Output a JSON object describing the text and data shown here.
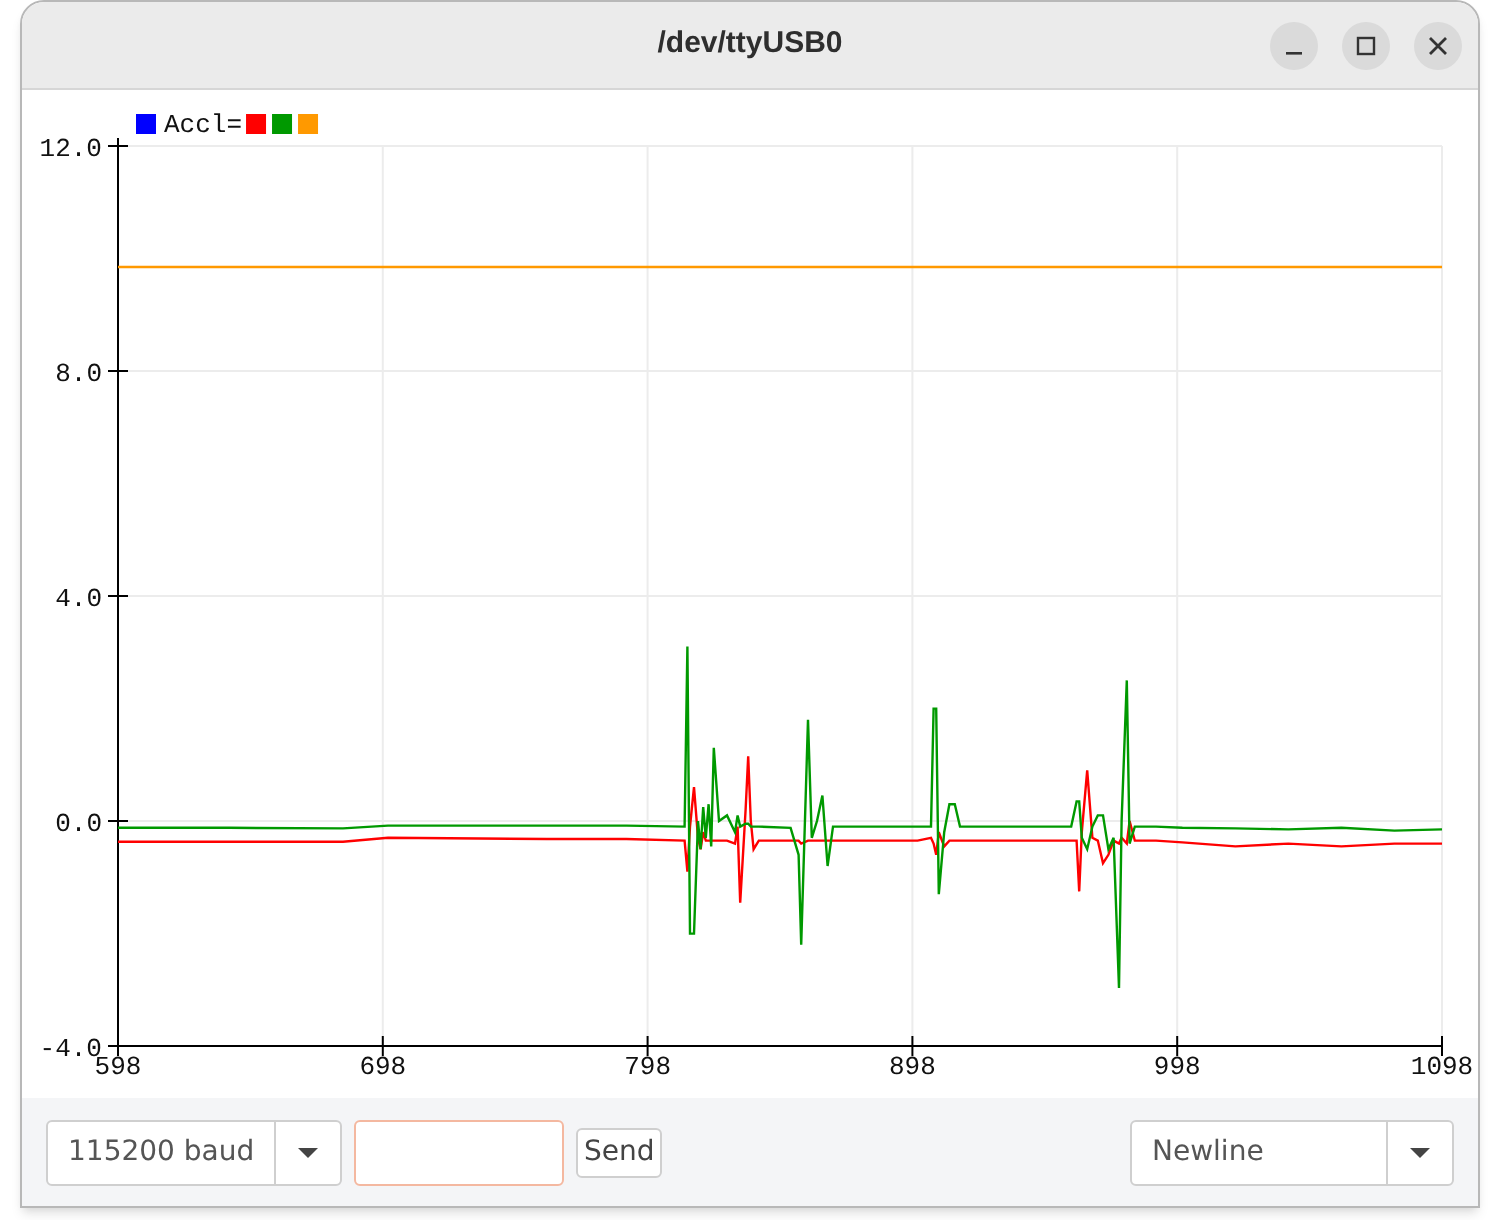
{
  "window": {
    "title": "/dev/ttyUSB0"
  },
  "plot": {
    "legend": {
      "label": "Accl=",
      "color": "#0000ff"
    },
    "chart_data": {
      "type": "line",
      "grid": true,
      "xlim": [
        598,
        1098
      ],
      "ylim": [
        -4,
        12
      ],
      "xticks": [
        598,
        698,
        798,
        898,
        998,
        1098
      ],
      "yticks": [
        {
          "value": 12,
          "label": "12.0"
        },
        {
          "value": 8,
          "label": "8.0"
        },
        {
          "value": 4,
          "label": "4.0"
        },
        {
          "value": 0,
          "label": "0.0"
        },
        {
          "value": -4,
          "label": "-4.0"
        }
      ],
      "x": [
        598,
        640,
        683,
        700,
        760,
        790,
        812,
        813,
        814,
        815.5,
        817,
        818,
        819,
        820,
        821,
        822,
        823,
        825,
        828,
        831,
        832,
        833,
        835,
        836,
        837,
        838,
        840,
        852,
        855,
        856,
        858.6,
        860,
        862,
        864,
        866,
        868,
        870,
        900,
        905,
        906,
        907,
        908,
        910,
        912,
        914,
        916,
        918,
        950,
        958,
        960,
        961,
        962,
        964,
        966,
        968,
        970,
        972,
        974,
        976,
        977,
        979,
        980,
        982,
        990,
        1000,
        1020,
        1040,
        1060,
        1080,
        1098
      ],
      "series": [
        {
          "color": "#ff0000",
          "values": [
            -0.37,
            -0.37,
            -0.37,
            -0.3,
            -0.32,
            -0.32,
            -0.35,
            -0.9,
            -0.1,
            0.6,
            -0.3,
            -0.5,
            -0.2,
            -0.35,
            -0.35,
            -0.35,
            -0.35,
            -0.35,
            -0.35,
            -0.4,
            -0.1,
            -1.45,
            0.2,
            1.15,
            0.0,
            -0.5,
            -0.35,
            -0.35,
            -0.35,
            -0.4,
            -0.35,
            -0.35,
            -0.35,
            -0.35,
            -0.35,
            -0.35,
            -0.35,
            -0.35,
            -0.3,
            -0.4,
            -0.6,
            -0.2,
            -0.45,
            -0.35,
            -0.35,
            -0.35,
            -0.35,
            -0.35,
            -0.35,
            -0.35,
            -1.25,
            -0.2,
            0.9,
            -0.3,
            -0.35,
            -0.75,
            -0.6,
            -0.35,
            -0.4,
            -0.3,
            -0.4,
            0.0,
            -0.35,
            -0.35,
            -0.38,
            -0.45,
            -0.4,
            -0.45,
            -0.4,
            -0.4
          ]
        },
        {
          "color": "#009900",
          "values": [
            -0.12,
            -0.12,
            -0.13,
            -0.08,
            -0.08,
            -0.08,
            -0.1,
            3.1,
            -2.0,
            -2.0,
            0.0,
            -0.5,
            0.25,
            -0.3,
            0.3,
            -0.45,
            1.3,
            0.0,
            0.1,
            -0.2,
            0.1,
            -0.1,
            -0.05,
            -0.05,
            -0.1,
            -0.1,
            -0.1,
            -0.12,
            -0.6,
            -2.2,
            1.8,
            -0.3,
            0.0,
            0.45,
            -0.8,
            -0.1,
            -0.1,
            -0.1,
            -0.1,
            2.0,
            2.0,
            -1.3,
            -0.2,
            0.3,
            0.3,
            -0.1,
            -0.1,
            -0.1,
            -0.1,
            0.35,
            0.35,
            -0.3,
            -0.5,
            -0.1,
            0.1,
            0.1,
            -0.5,
            -0.3,
            -2.97,
            0.0,
            2.5,
            -0.4,
            -0.1,
            -0.1,
            -0.12,
            -0.13,
            -0.15,
            -0.12,
            -0.17,
            -0.15
          ]
        },
        {
          "color": "#ff9900",
          "values": [
            9.85,
            9.85,
            9.85,
            9.85,
            9.85,
            9.85,
            9.85,
            9.85,
            9.85,
            9.85,
            9.85,
            9.85,
            9.85,
            9.85,
            9.85,
            9.85,
            9.85,
            9.85,
            9.85,
            9.85,
            9.85,
            9.85,
            9.85,
            9.85,
            9.85,
            9.85,
            9.85,
            9.85,
            9.85,
            9.85,
            9.85,
            9.85,
            9.85,
            9.85,
            9.85,
            9.85,
            9.85,
            9.85,
            9.85,
            9.85,
            9.85,
            9.85,
            9.85,
            9.85,
            9.85,
            9.85,
            9.85,
            9.85,
            9.85,
            9.85,
            9.85,
            9.85,
            9.85,
            9.85,
            9.85,
            9.85,
            9.85,
            9.85,
            9.85,
            9.85,
            9.85,
            9.85,
            9.85,
            9.85,
            9.85,
            9.85,
            9.85,
            9.85,
            9.85,
            9.85
          ]
        }
      ]
    }
  },
  "controls": {
    "baud": {
      "value": "115200 baud"
    },
    "message_field": {
      "focused": true
    },
    "send_button": "Send",
    "line_ending": {
      "value": "Newline"
    }
  }
}
